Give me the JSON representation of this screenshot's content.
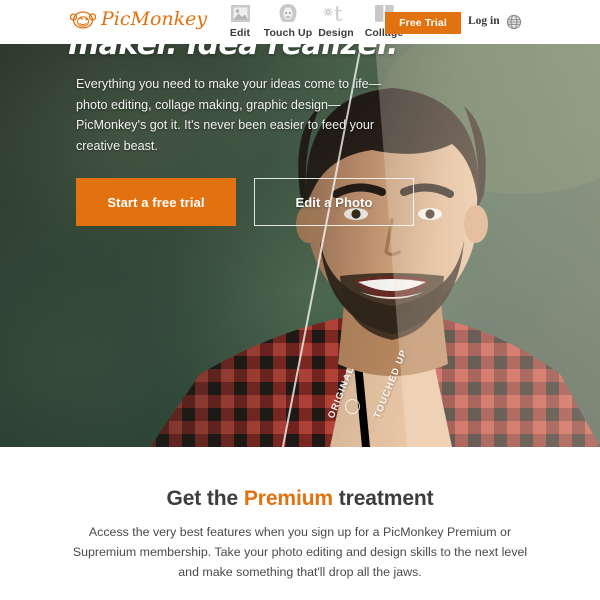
{
  "header": {
    "logo": {
      "name": "PicMonkey",
      "icon": "monkey-logo-icon"
    },
    "nav": [
      {
        "label": "Edit",
        "icon": "picture-icon"
      },
      {
        "label": "Touch Up",
        "icon": "face-portrait-icon"
      },
      {
        "label": "Design",
        "icon": "text-t-sparkle-icon"
      },
      {
        "label": "Collage",
        "icon": "grid-panels-icon"
      }
    ],
    "free_trial_label": "Free Trial",
    "login_label": "Log in",
    "language_icon": "globe-icon"
  },
  "hero": {
    "headline": "maker. Idea realizer.",
    "subhead": "Everything you need to make your ideas come to life—photo editing, collage making, graphic design—PicMonkey's got it. It's never been easier to feed your creative beast.",
    "primary_cta": "Start a free trial",
    "secondary_cta": "Edit a Photo",
    "compare": {
      "before_label": "ORIGINAL",
      "after_label": "TOUCHED UP"
    }
  },
  "premium": {
    "title_before": "Get the ",
    "title_highlight": "Premium",
    "title_after": " treatment",
    "body": "Access the very best features when you sign up for a PicMonkey Premium or Supremium membership. Take your photo editing and design skills to the next level and make something that'll drop all the jaws."
  },
  "colors": {
    "brand_orange": "#e2710f",
    "text_dark": "#3d3d3d",
    "header_bg": "#ffffff"
  }
}
